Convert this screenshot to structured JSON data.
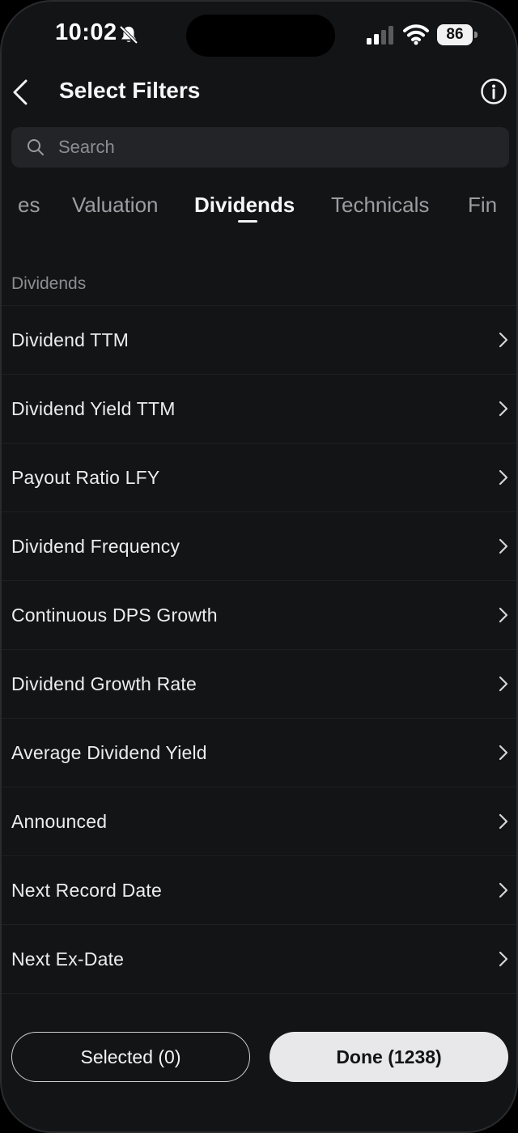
{
  "status_bar": {
    "time": "10:02",
    "battery": "86",
    "icons": [
      "bell-slash-icon",
      "signal-icon",
      "wifi-icon",
      "battery-icon"
    ]
  },
  "header": {
    "title": "Select Filters",
    "back_icon": "chevron-left-icon",
    "info_icon": "info-circle-icon"
  },
  "search": {
    "placeholder": "Search",
    "value": ""
  },
  "tabs": [
    {
      "label": "es",
      "active": false
    },
    {
      "label": "Valuation",
      "active": false
    },
    {
      "label": "Dividends",
      "active": true
    },
    {
      "label": "Technicals",
      "active": false
    },
    {
      "label": "Fin",
      "active": false
    }
  ],
  "section": {
    "title": "Dividends",
    "items": [
      {
        "label": "Dividend TTM"
      },
      {
        "label": "Dividend Yield TTM"
      },
      {
        "label": "Payout Ratio LFY"
      },
      {
        "label": "Dividend Frequency"
      },
      {
        "label": "Continuous DPS Growth"
      },
      {
        "label": "Dividend Growth Rate"
      },
      {
        "label": "Average Dividend Yield"
      },
      {
        "label": "Announced"
      },
      {
        "label": "Next Record Date"
      },
      {
        "label": "Next Ex-Date"
      }
    ]
  },
  "footer": {
    "selected_label": "Selected (0)",
    "done_label": "Done (1238)"
  },
  "colors": {
    "background": "#131416",
    "search_bg": "#232427",
    "text_primary": "#ececef",
    "text_secondary": "#8c8d92",
    "done_button_bg": "#e8e8ea"
  }
}
